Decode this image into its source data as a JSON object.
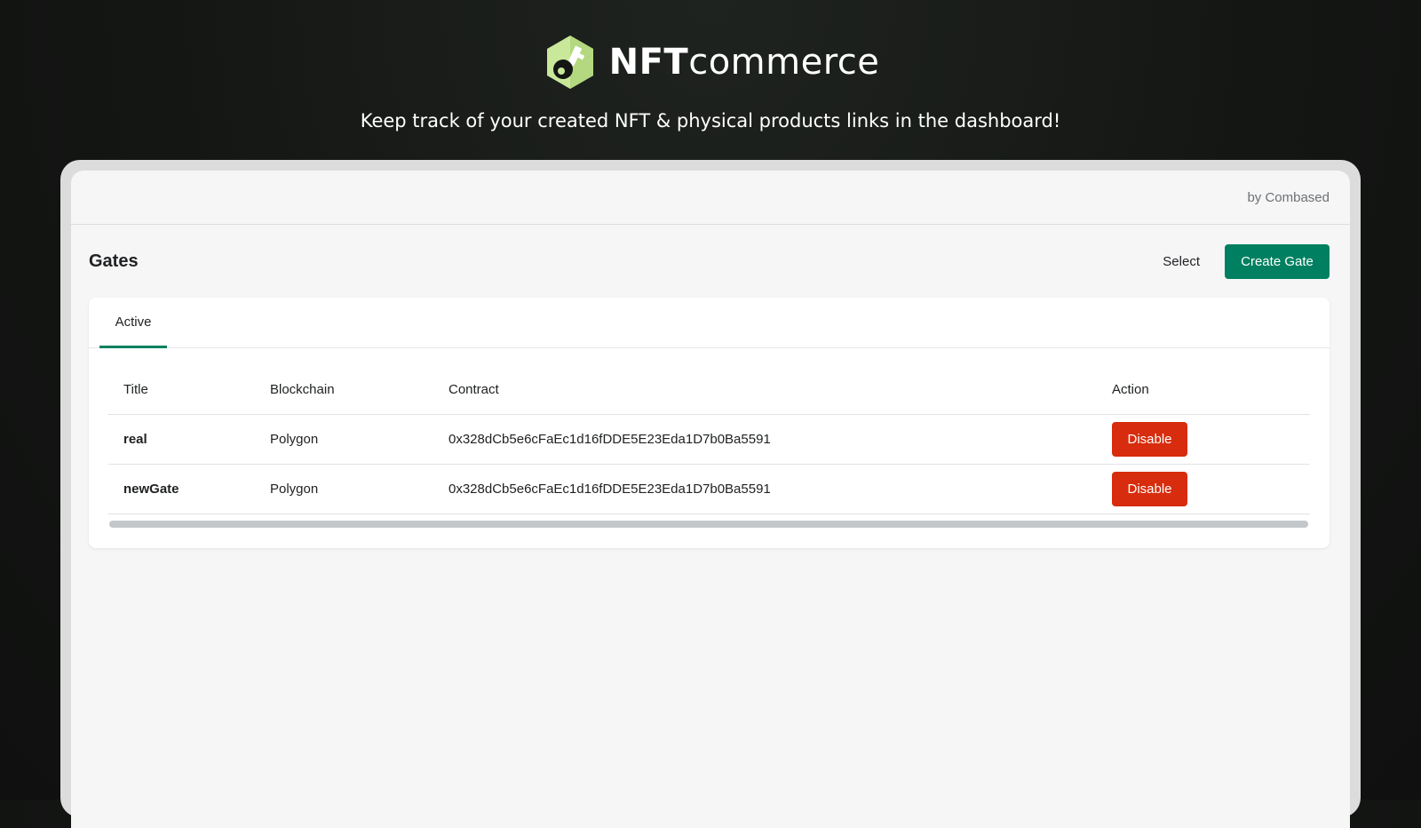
{
  "brand": {
    "name_bold": "NFT",
    "name_light": "commerce",
    "tagline": "Keep track of your created NFT & physical products links in the dashboard!"
  },
  "topbar": {
    "by_line": "by Combased"
  },
  "header": {
    "title": "Gates",
    "select_label": "Select",
    "create_label": "Create Gate"
  },
  "tabs": [
    {
      "label": "Active",
      "selected": true
    }
  ],
  "table": {
    "columns": [
      "Title",
      "Blockchain",
      "Contract",
      "Action"
    ],
    "rows": [
      {
        "title": "real",
        "blockchain": "Polygon",
        "contract": "0x328dCb5e6cFaEc1d16fDDE5E23Eda1D7b0Ba5591",
        "action": "Disable"
      },
      {
        "title": "newGate",
        "blockchain": "Polygon",
        "contract": "0x328dCb5e6cFaEc1d16fDDE5E23Eda1D7b0Ba5591",
        "action": "Disable"
      }
    ]
  },
  "colors": {
    "primary": "#008060",
    "danger": "#d72c0d",
    "logo": "#c9e89a"
  },
  "icons": {
    "logo": "key-hexagon-icon"
  }
}
